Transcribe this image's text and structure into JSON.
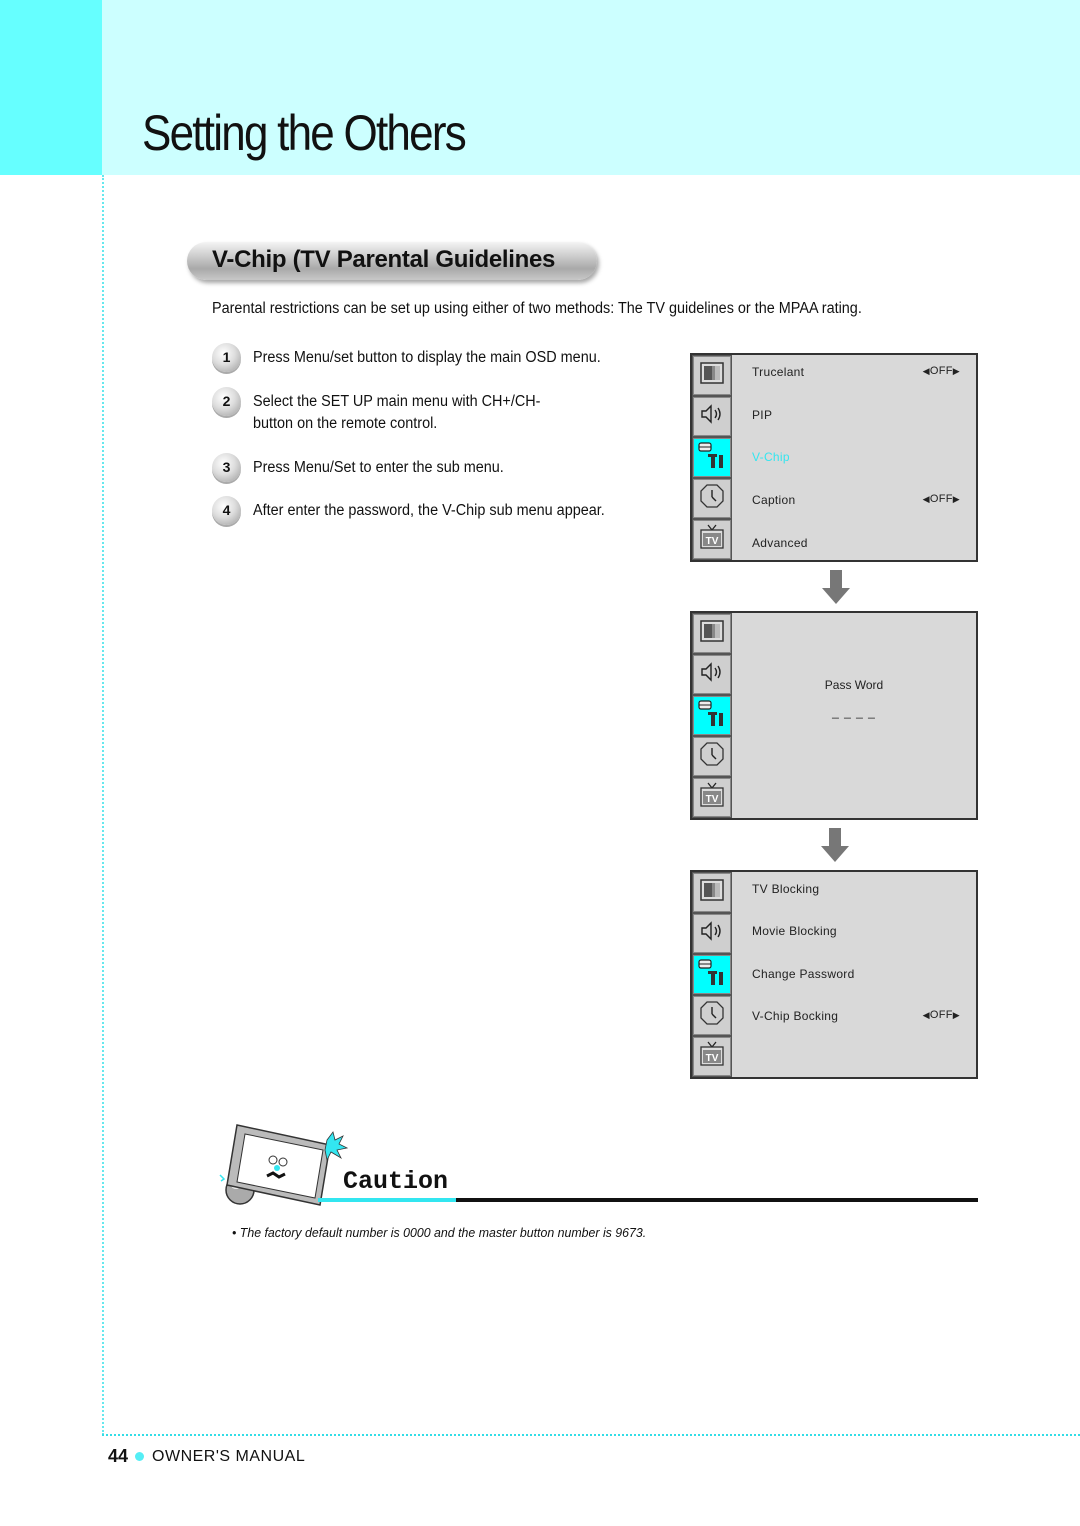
{
  "header": {
    "title": "Setting the Others"
  },
  "section": {
    "title": "V-Chip (TV Parental Guidelines",
    "intro": "Parental restrictions can be set up using either of two methods: The TV guidelines or the MPAA rating."
  },
  "steps": [
    {
      "num": "1",
      "lines": [
        "Press Menu/set button to display the main OSD menu."
      ]
    },
    {
      "num": "2",
      "lines": [
        "Select the SET UP main menu with CH+/CH-",
        "button on the remote control."
      ]
    },
    {
      "num": "3",
      "lines": [
        "Press Menu/Set to enter the sub menu."
      ]
    },
    {
      "num": "4",
      "lines": [
        "After enter the password, the V-Chip sub menu appear."
      ]
    }
  ],
  "osd_icons": [
    "picture-icon",
    "sound-icon",
    "setup-tools-icon",
    "timer-clock-icon",
    "tv-icon"
  ],
  "osd_active_icon": 2,
  "osd_screens": [
    {
      "name": "setup-menu",
      "items": [
        {
          "label": "Trucelant",
          "value": "OFF",
          "highlight": false
        },
        {
          "label": "PIP",
          "value": "",
          "highlight": false
        },
        {
          "label": "V-Chip",
          "value": "",
          "highlight": true
        },
        {
          "label": "Caption",
          "value": "OFF",
          "highlight": false
        },
        {
          "label": "Advanced",
          "value": "",
          "highlight": false
        }
      ]
    },
    {
      "name": "password-screen",
      "prompt": "Pass Word",
      "entry": "_ _ _ _"
    },
    {
      "name": "vchip-submenu",
      "items": [
        {
          "label": "TV Blocking",
          "value": "",
          "highlight": false
        },
        {
          "label": "Movie Blocking",
          "value": "",
          "highlight": false
        },
        {
          "label": "Change Password",
          "value": "",
          "highlight": false
        },
        {
          "label": "V-Chip Bocking",
          "value": "OFF",
          "highlight": false
        }
      ]
    }
  ],
  "arrows": {
    "left": "◀",
    "right": "▶"
  },
  "caution": {
    "title": "Caution",
    "bullet": "•",
    "note": "The factory default number is 0000 and the master button number is 9673."
  },
  "footer": {
    "page_number": "44",
    "label": "OWNER'S MANUAL"
  },
  "colors": {
    "header_band": "#ccffff",
    "header_tab": "#66ffff",
    "accent_cyan": "#00ffff",
    "highlight_text": "#33e6f0",
    "osd_bg": "#d9d9d9"
  }
}
